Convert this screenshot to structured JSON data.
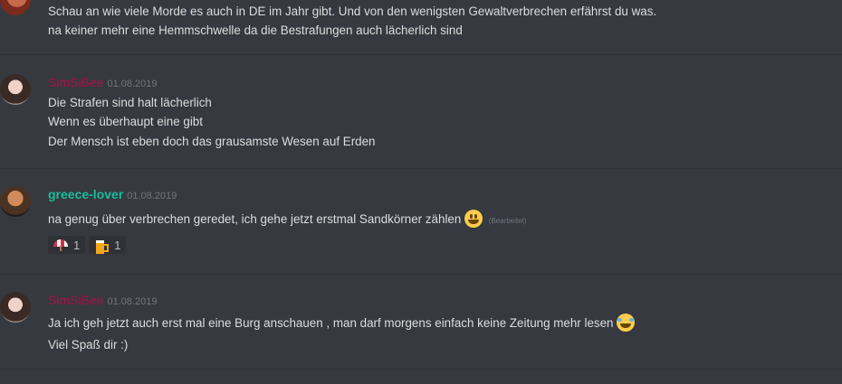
{
  "messages": [
    {
      "lines": [
        "Schau an wie viele Morde  es auch in DE im Jahr gibt. Und von den wenigsten Gewaltverbrechen erfährst du was.",
        "na keiner mehr eine Hemmschwelle da die Bestrafungen auch lächerlich sind"
      ]
    },
    {
      "user": "SimSiBee",
      "timestamp": "01.08.2019",
      "lines": [
        "Die Strafen sind halt lächerlich",
        "Wenn es überhaupt eine gibt",
        "Der Mensch ist eben doch das grausamste Wesen auf Erden"
      ]
    },
    {
      "user": "greece-lover",
      "timestamp": "01.08.2019",
      "lines": [
        "na genug über verbrechen geredet, ich gehe jetzt erstmal Sandkörner zählen"
      ],
      "edited": "(Bearbeitet)",
      "reactions": [
        {
          "icon": "umbrella-on-ground-icon",
          "count": "1"
        },
        {
          "icon": "beer-icon",
          "count": "1"
        }
      ]
    },
    {
      "user": "SimSiBee",
      "timestamp": "01.08.2019",
      "lines": [
        "Ja ich geh jetzt auch erst mal eine Burg anschauen , man darf morgens einfach keine Zeitung mehr lesen",
        "Viel Spaß dir :)"
      ]
    }
  ],
  "colors": {
    "background": "#36393f",
    "simsibee": "#a3124a",
    "greece_lover": "#1abc9c"
  }
}
